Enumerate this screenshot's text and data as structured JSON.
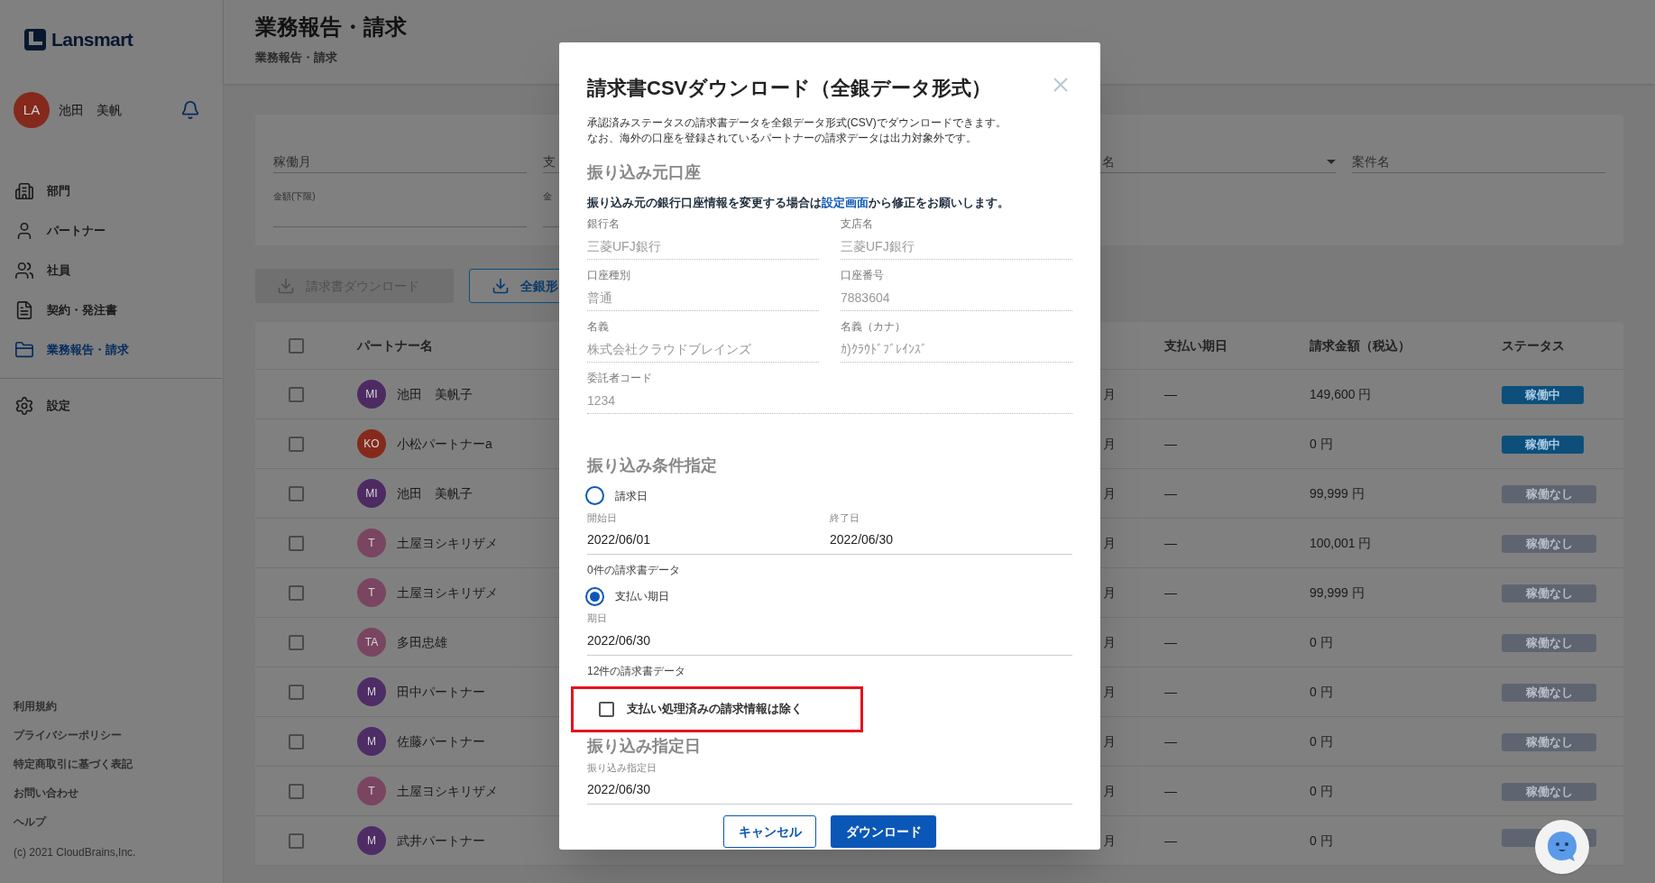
{
  "sidebar": {
    "logo": "Lansmart",
    "user": {
      "initials": "LA",
      "name": "池田　美帆",
      "color": "#85291c"
    },
    "nav": [
      {
        "label": "部門",
        "selected": false
      },
      {
        "label": "パートナー",
        "selected": false
      },
      {
        "label": "社員",
        "selected": false
      },
      {
        "label": "契約・発注書",
        "selected": false
      },
      {
        "label": "業務報告・請求",
        "selected": true
      }
    ],
    "settings": {
      "label": "設定",
      "selected": false
    },
    "footer_links": [
      "利用規約",
      "プライバシーポリシー",
      "特定商取引に基づく表記",
      "お問い合わせ",
      "ヘルプ"
    ],
    "copyright": "(c) 2021 CloudBrains,Inc."
  },
  "header": {
    "title": "業務報告・請求",
    "breadcrumb": "業務報告・請求"
  },
  "filters": {
    "fields": [
      {
        "placeholder": "稼働月"
      },
      {
        "placeholder": "支"
      },
      {
        "placeholder": "名",
        "kind": "select"
      },
      {
        "placeholder": "案件名"
      }
    ],
    "range_fields": [
      {
        "label": "金額(下限)"
      },
      {
        "label": "金"
      }
    ]
  },
  "toolbar": [
    {
      "label": "請求書ダウンロード",
      "disabled": true
    },
    {
      "label": "全銀形",
      "disabled": false
    }
  ],
  "table": {
    "header_checkbox": {
      "checked": false
    },
    "columns": [
      {
        "label": "パートナー名"
      },
      {
        "label": "支払い期日"
      },
      {
        "label": "請求金額（税込）"
      },
      {
        "label": "ステータス"
      }
    ],
    "rows": [
      {
        "checked": false,
        "initials": "MI",
        "color": "#4d2b62",
        "name": "池田　美帆子",
        "column_3": "月",
        "due": "—",
        "amount": "149,600 円",
        "status": "稼働中",
        "kind": "active"
      },
      {
        "checked": false,
        "initials": "KO",
        "color": "#86291d",
        "name": "小松パートナーa",
        "column_3": "月",
        "due": "—",
        "amount": "0 円",
        "status": "稼働中",
        "kind": "active"
      },
      {
        "checked": false,
        "initials": "MI",
        "color": "#4d2b62",
        "name": "池田　美帆子",
        "column_3": "月",
        "due": "—",
        "amount": "99,999 円",
        "status": "稼働なし",
        "kind": "inactive"
      },
      {
        "checked": false,
        "initials": "T",
        "color": "#7a4560",
        "name": "土屋ヨシキリザメ",
        "column_3": "月",
        "due": "—",
        "amount": "100,001 円",
        "status": "稼働なし",
        "kind": "inactive"
      },
      {
        "checked": false,
        "initials": "T",
        "color": "#7a4560",
        "name": "土屋ヨシキリザメ",
        "column_3": "月",
        "due": "—",
        "amount": "99,999 円",
        "status": "稼働なし",
        "kind": "inactive"
      },
      {
        "checked": false,
        "initials": "TA",
        "color": "#7a4560",
        "name": "多田忠雄",
        "column_3": "月",
        "due": "—",
        "amount": "0 円",
        "status": "稼働なし",
        "kind": "inactive"
      },
      {
        "checked": false,
        "initials": "M",
        "color": "#4e2d66",
        "name": "田中パートナー",
        "column_3": "月",
        "due": "—",
        "amount": "0 円",
        "status": "稼働なし",
        "kind": "inactive"
      },
      {
        "checked": false,
        "initials": "M",
        "color": "#4e2d66",
        "name": "佐藤パートナー",
        "column_3": "月",
        "due": "—",
        "amount": "0 円",
        "status": "稼働なし",
        "kind": "inactive"
      },
      {
        "checked": false,
        "initials": "T",
        "color": "#7a4560",
        "name": "土屋ヨシキリザメ",
        "column_3": "月",
        "due": "—",
        "amount": "0 円",
        "status": "稼働なし",
        "kind": "inactive"
      },
      {
        "checked": false,
        "initials": "M",
        "color": "#4e2d66",
        "name": "武井パートナー",
        "column_3": "月",
        "due": "—",
        "amount": "0 円",
        "kind": "inactive"
      }
    ]
  },
  "dialog": {
    "title": "請求書CSVダウンロード（全銀データ形式）",
    "description": [
      "承認済みステータスの請求書データを全銀データ形式(CSV)でダウンロードできます。",
      "なお、海外の口座を登録されているパートナーの請求データは出力対象外です。"
    ],
    "source_account": {
      "heading": "振り込み元口座",
      "note": {
        "before": "振り込み元の銀行口座情報を変更する場合は",
        "link": "設定画面",
        "after": "から修正をお願いします。"
      },
      "fields": [
        {
          "label": "銀行名",
          "value": "三菱UFJ銀行",
          "disabled": true
        },
        {
          "label": "支店名",
          "value": "三菱UFJ銀行",
          "disabled": true
        },
        {
          "label": "口座種別",
          "value": "普通",
          "disabled": true
        },
        {
          "label": "口座番号",
          "value": "7883604",
          "disabled": true
        },
        {
          "label": "名義",
          "value": "株式会社クラウドブレインズ",
          "disabled": true
        },
        {
          "label": "名義（カナ）",
          "value": "ｶ)ｸﾗｳﾄﾞﾌﾞﾚｲﾝｽﾞ",
          "disabled": true
        },
        {
          "label": "委託者コード",
          "value": "1234",
          "disabled": true
        }
      ]
    },
    "conditions": {
      "heading": "振り込み条件指定",
      "options": [
        {
          "label": "請求日",
          "selected": false,
          "fields": [
            {
              "label": "開始日",
              "value": "2022/06/01"
            },
            {
              "label": "終了日",
              "value": "2022/06/30"
            }
          ],
          "count": "0件の請求書データ"
        },
        {
          "label": "支払い期日",
          "selected": true,
          "fields": [
            {
              "label": "期日",
              "value": "2022/06/30"
            }
          ],
          "count": "12件の請求書データ"
        }
      ],
      "exclude_paid": {
        "label": "支払い処理済みの請求情報は除く",
        "checked": false,
        "highlighted": true
      }
    },
    "transfer_date": {
      "heading": "振り込み指定日",
      "label": "振り込み指定日",
      "value": "2022/06/30"
    },
    "buttons": [
      {
        "label": "キャンセル",
        "kind": "secondary"
      },
      {
        "label": "ダウンロード",
        "kind": "primary"
      }
    ]
  }
}
